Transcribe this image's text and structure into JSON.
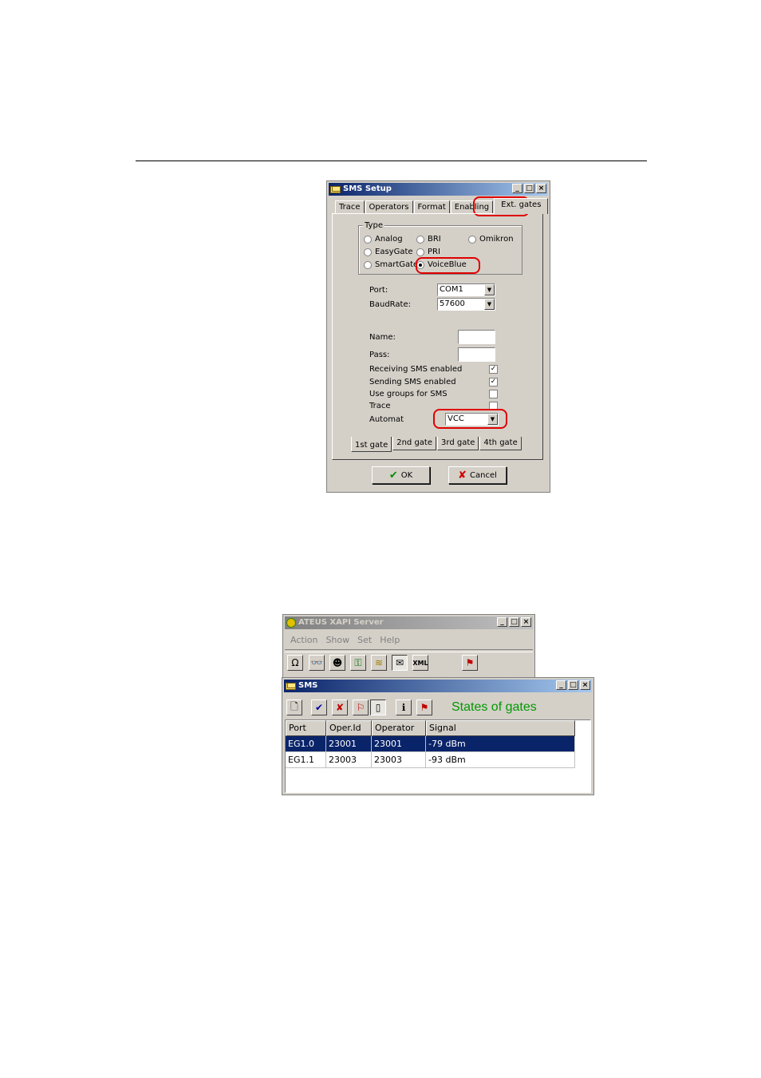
{
  "sms_setup": {
    "title": "SMS Setup",
    "tabs": [
      "Trace",
      "Operators",
      "Format",
      "Enabling",
      "Ext. gates"
    ],
    "type_group": {
      "legend": "Type",
      "options": [
        "Analog",
        "BRI",
        "Omikron",
        "EasyGate",
        "PRI",
        "SmartGate",
        "VoiceBlue"
      ],
      "selected": "VoiceBlue"
    },
    "port_label": "Port:",
    "port_value": "COM1",
    "baud_label": "BaudRate:",
    "baud_value": "57600",
    "name_label": "Name:",
    "pass_label": "Pass:",
    "checks": [
      {
        "label": "Receiving SMS enabled",
        "checked": true
      },
      {
        "label": "Sending SMS enabled",
        "checked": true
      },
      {
        "label": "Use groups for SMS",
        "checked": false
      },
      {
        "label": "Trace",
        "checked": false
      }
    ],
    "automat_label": "Automat",
    "automat_value": "VCC",
    "gate_tabs": [
      "1st gate",
      "2nd gate",
      "3rd gate",
      "4th gate"
    ],
    "ok_label": "OK",
    "cancel_label": "Cancel",
    "highlight_color": "#e00000"
  },
  "xapi_server": {
    "title": "ATEUS XAPI Server",
    "menu": [
      "Action",
      "Show",
      "Set",
      "Help"
    ],
    "toolbar_icons": [
      "omega-icon",
      "glasses-icon",
      "user-icon",
      "key-icon",
      "database-icon",
      "envelope-icon",
      "xml-icon",
      "exit-icon"
    ]
  },
  "sms_window": {
    "title": "SMS",
    "heading": "States of gates",
    "heading_color": "#009900",
    "columns": [
      "Port",
      "Oper.Id",
      "Operator",
      "Signal"
    ],
    "rows": [
      [
        "EG1.0",
        "23001",
        "23001",
        "-79 dBm"
      ],
      [
        "EG1.1",
        "23003",
        "23003",
        "-93 dBm"
      ]
    ]
  }
}
